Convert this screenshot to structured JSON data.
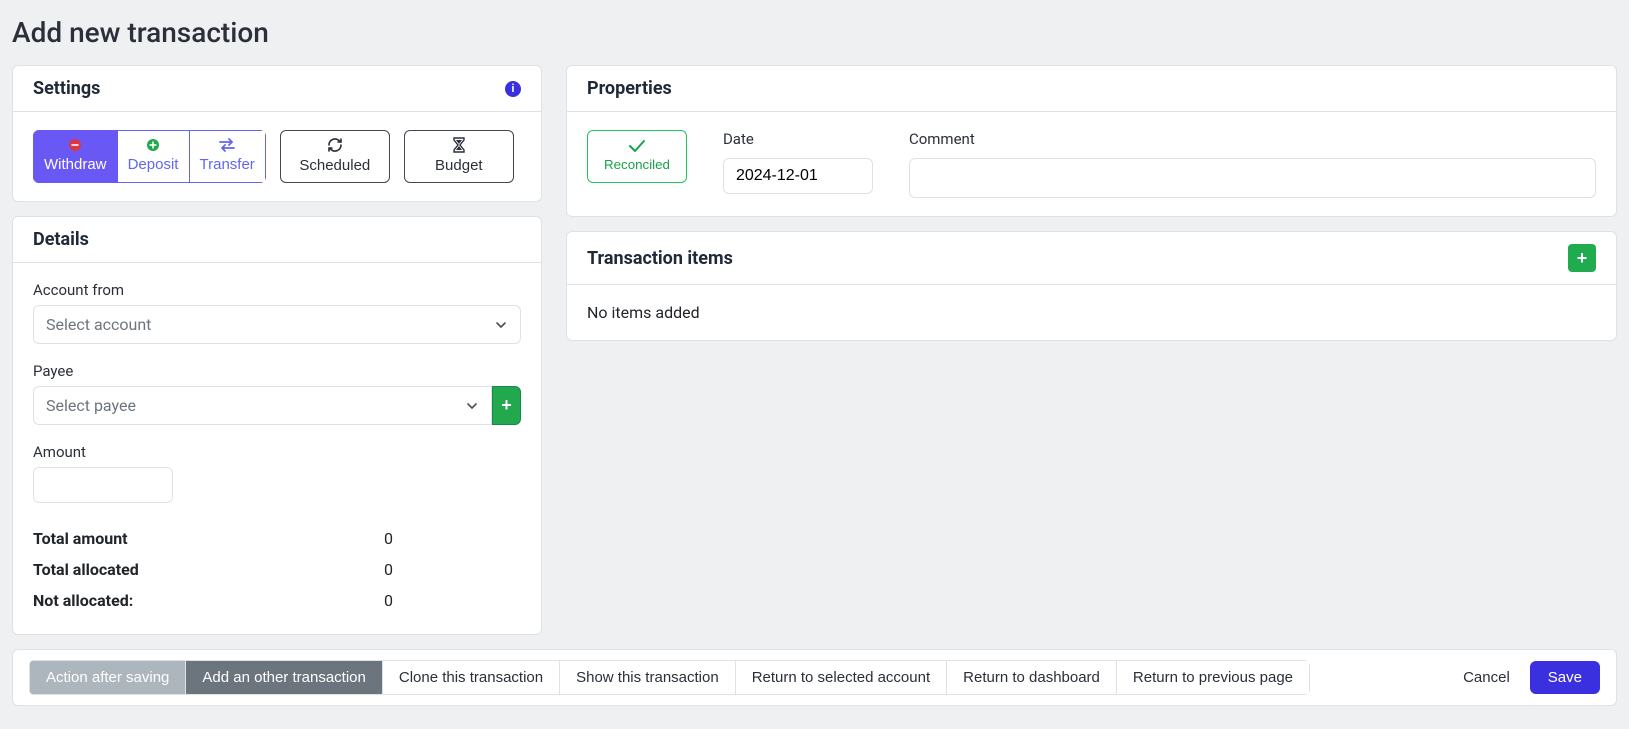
{
  "page": {
    "title": "Add new transaction"
  },
  "settings": {
    "heading": "Settings",
    "types": {
      "withdraw": "Withdraw",
      "deposit": "Deposit",
      "transfer": "Transfer"
    },
    "scheduled": "Scheduled",
    "budget": "Budget"
  },
  "details": {
    "heading": "Details",
    "account_from_label": "Account from",
    "account_placeholder": "Select account",
    "payee_label": "Payee",
    "payee_placeholder": "Select payee",
    "amount_label": "Amount",
    "totals": {
      "total_amount_label": "Total amount",
      "total_amount_value": "0",
      "total_allocated_label": "Total allocated",
      "total_allocated_value": "0",
      "not_allocated_label": "Not allocated:",
      "not_allocated_value": "0"
    }
  },
  "properties": {
    "heading": "Properties",
    "reconciled": "Reconciled",
    "date_label": "Date",
    "date_value": "2024-12-01",
    "comment_label": "Comment",
    "comment_value": ""
  },
  "transaction_items": {
    "heading": "Transaction items",
    "empty": "No items added"
  },
  "footer": {
    "action_after_saving": "Action after saving",
    "options": [
      "Add an other transaction",
      "Clone this transaction",
      "Show this transaction",
      "Return to selected account",
      "Return to dashboard",
      "Return to previous page"
    ],
    "cancel": "Cancel",
    "save": "Save"
  }
}
